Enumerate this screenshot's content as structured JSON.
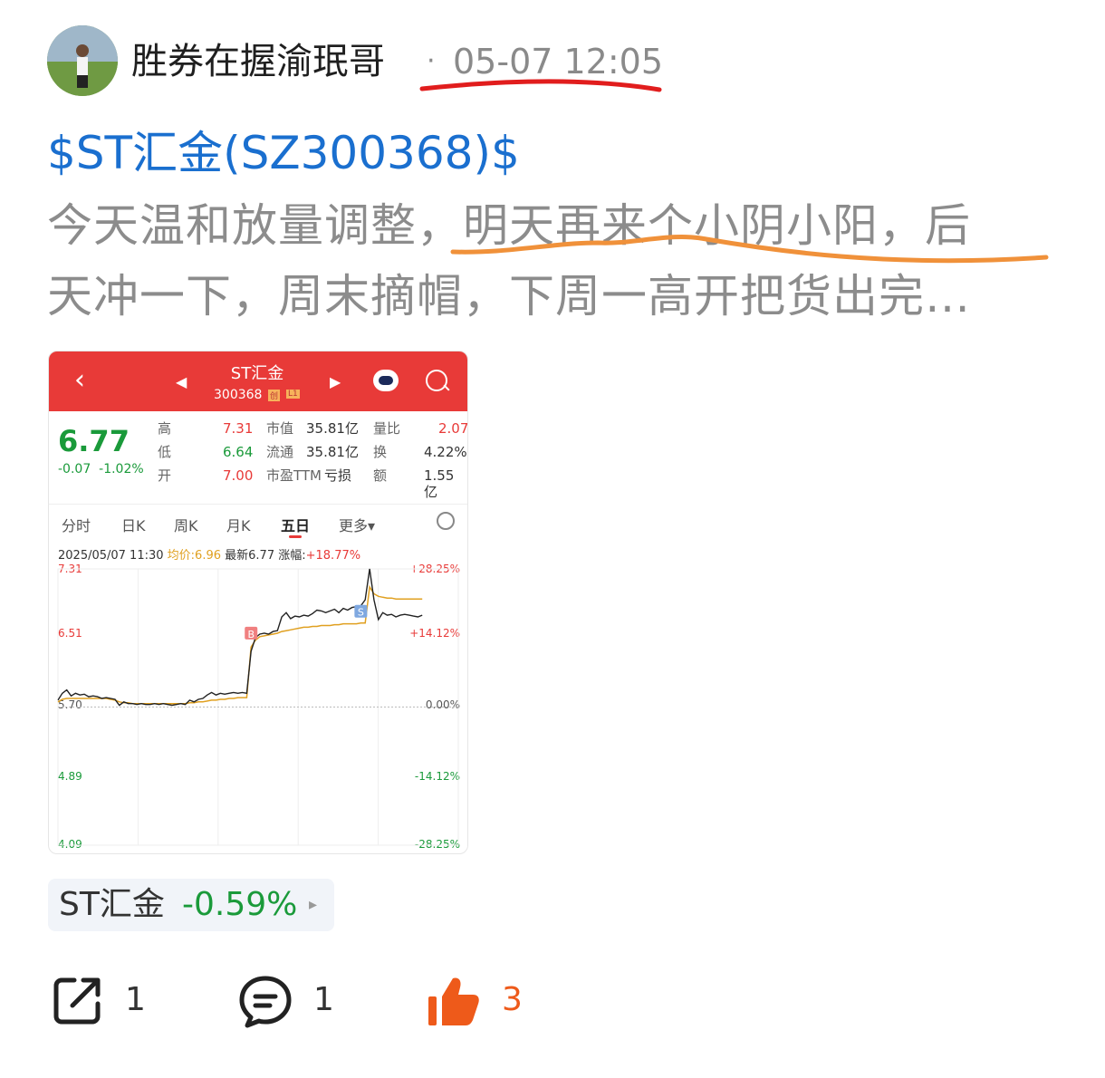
{
  "post": {
    "author": "胜券在握渝珉哥",
    "separator": "·",
    "timestamp": "05-07 12:05",
    "ticker_link": "$ST汇金(SZ300368)$",
    "body_line1": "今天温和放量调整，明天再来个小阴小阳，后",
    "body_line2": "天冲一下，周末摘帽，下周一高开把货出完…"
  },
  "screenshot": {
    "back_icon": "chevron-left-icon",
    "stock_name": "ST汇金",
    "stock_code": "300368",
    "tag1": "创",
    "tag2": "L1",
    "price": "6.77",
    "change": "-0.07",
    "change_pct": "-1.02%",
    "quotes": [
      {
        "label": "高",
        "value": "7.31",
        "label2": "市值",
        "value2": "35.81亿",
        "label3": "量比",
        "value3": "2.07"
      },
      {
        "label": "低",
        "value": "6.64",
        "label2": "流通",
        "value2": "35.81亿",
        "label3": "换",
        "value3": "4.22%"
      },
      {
        "label": "开",
        "value": "7.00",
        "label2": "市盈TTM",
        "value2": "亏损",
        "label3": "额",
        "value3": "1.55亿"
      }
    ],
    "tabs": [
      "分时",
      "日K",
      "周K",
      "月K",
      "五日",
      "更多▾"
    ],
    "active_tab": "五日",
    "info_date": "2025/05/07 11:30",
    "info_avg": "均价:6.96",
    "info_latest": "最新6.77",
    "info_pct_label": "涨幅:",
    "info_pct": "+18.77%",
    "axis_left": [
      "7.31",
      "6.51",
      "5.70",
      "4.89",
      "4.09"
    ],
    "axis_right": [
      "+28.25%",
      "+14.12%",
      "0.00%",
      "-14.12%",
      "-28.25%"
    ],
    "markers": {
      "buy": "B",
      "sell": "S"
    },
    "colors": {
      "header": "#e83a38",
      "price_line": "#222222",
      "avg_line": "#e0a020",
      "up": "#e83a38",
      "down": "#1a9a3a"
    }
  },
  "chart_data": {
    "type": "line",
    "title": "",
    "xlabel": "",
    "ylabel": "",
    "ylim": [
      4.09,
      7.31
    ],
    "reference": 5.7,
    "grid": true,
    "series": [
      {
        "name": "",
        "values": [
          5.78,
          5.86,
          5.9,
          5.83,
          5.86,
          5.84,
          5.85,
          5.82,
          5.83,
          5.82,
          5.8,
          5.81,
          5.8,
          5.79,
          5.72,
          5.76,
          5.74,
          5.74,
          5.73,
          5.74,
          5.73,
          5.73,
          5.74,
          5.73,
          5.74,
          5.73,
          5.72,
          5.73,
          5.74,
          5.73,
          5.78,
          5.76,
          5.79,
          5.8,
          5.84,
          5.87,
          5.84,
          5.86,
          5.85,
          5.86,
          5.87,
          5.86,
          5.87,
          5.86,
          6.35,
          6.51,
          6.55,
          6.56,
          6.55,
          6.58,
          6.59,
          6.75,
          6.8,
          6.73,
          6.76,
          6.75,
          6.77,
          6.76,
          6.79,
          6.83,
          6.82,
          6.8,
          6.82,
          6.84,
          6.8,
          6.85,
          6.83,
          6.86,
          6.87,
          6.88,
          6.95,
          7.31,
          6.95,
          6.72,
          6.8,
          6.77,
          6.78,
          6.75,
          6.77,
          6.78,
          6.77,
          6.76,
          6.75,
          6.77
        ]
      },
      {
        "name": "",
        "values": [
          5.76,
          5.79,
          5.8,
          5.8,
          5.8,
          5.8,
          5.8,
          5.8,
          5.8,
          5.8,
          5.8,
          5.8,
          5.79,
          5.78,
          5.76,
          5.75,
          5.75,
          5.74,
          5.74,
          5.74,
          5.74,
          5.74,
          5.74,
          5.74,
          5.74,
          5.74,
          5.74,
          5.74,
          5.74,
          5.74,
          5.75,
          5.75,
          5.76,
          5.76,
          5.77,
          5.78,
          5.78,
          5.79,
          5.79,
          5.8,
          5.8,
          5.81,
          5.81,
          5.81,
          6.4,
          6.48,
          6.52,
          6.53,
          6.54,
          6.55,
          6.56,
          6.58,
          6.59,
          6.6,
          6.61,
          6.62,
          6.63,
          6.63,
          6.64,
          6.64,
          6.65,
          6.65,
          6.65,
          6.66,
          6.66,
          6.67,
          6.67,
          6.67,
          6.67,
          6.68,
          6.68,
          7.1,
          7.02,
          6.99,
          6.98,
          6.97,
          6.97,
          6.96,
          6.96,
          6.96,
          6.96,
          6.96,
          6.96,
          6.96
        ]
      }
    ]
  },
  "stock_chip": {
    "name": "ST汇金",
    "pct": "-0.59%",
    "arrow": "▸"
  },
  "actions": {
    "share_count": "1",
    "comment_count": "1",
    "like_count": "3"
  }
}
